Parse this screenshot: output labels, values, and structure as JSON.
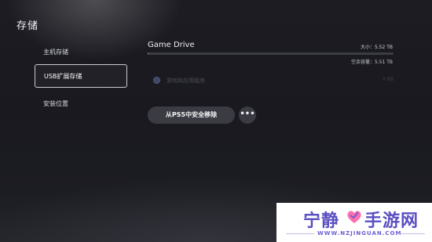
{
  "page": {
    "title": "存储"
  },
  "sidebar": {
    "items": [
      {
        "label": "主机存储",
        "selected": false
      },
      {
        "label": "USB扩展存储",
        "selected": true
      },
      {
        "label": "安装位置",
        "selected": false
      }
    ]
  },
  "drive": {
    "name": "Game Drive",
    "size_text": "大小：5.52 TB",
    "free_text": "空余容量：5.51 TB",
    "used_fraction": 0.002
  },
  "apps_row": {
    "label": "游戏和应用程序",
    "size_text": "0 KB",
    "icon": "app-circle-icon"
  },
  "actions": {
    "remove_label": "从PS5中安全移除",
    "more_label": "•••",
    "more_icon": "more-options-icon"
  },
  "watermark": {
    "text_left": "宁静",
    "text_right": "手游网",
    "url": "WWW.NZJINGUAN.COM",
    "logo_icon": "heart-logo-icon"
  },
  "colors": {
    "background": "#1b1b21",
    "accent": "#5a4fc2",
    "button": "#3b3c43"
  }
}
